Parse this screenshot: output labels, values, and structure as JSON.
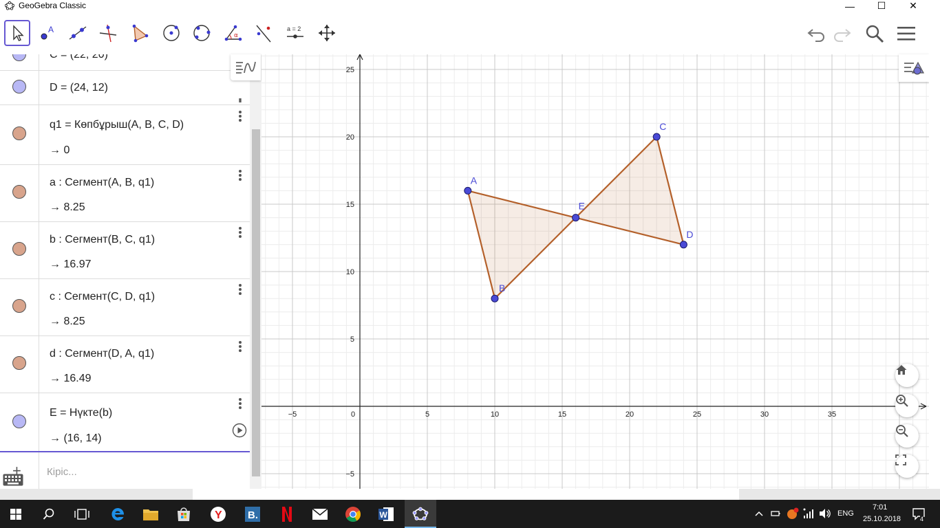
{
  "window": {
    "title": "GeoGebra Classic",
    "controls": {
      "minimize": "—",
      "maximize": "☐",
      "close": "✕"
    }
  },
  "toolbar": {
    "tools": [
      {
        "name": "move-tool",
        "icon": "cursor-arrow-icon",
        "selected": true
      },
      {
        "name": "point-tool",
        "icon": "point-icon",
        "label": "A"
      },
      {
        "name": "line-tool",
        "icon": "line-through-points-icon"
      },
      {
        "name": "perpendicular-tool",
        "icon": "perpendicular-line-icon"
      },
      {
        "name": "polygon-tool",
        "icon": "polygon-icon"
      },
      {
        "name": "circle-tool",
        "icon": "circle-center-point-icon"
      },
      {
        "name": "conic-tool",
        "icon": "ellipse-icon"
      },
      {
        "name": "angle-tool",
        "icon": "angle-icon",
        "label": "α"
      },
      {
        "name": "reflect-tool",
        "icon": "reflect-about-line-icon"
      },
      {
        "name": "slider-tool",
        "icon": "slider-icon",
        "label": "a = 2"
      },
      {
        "name": "move-graphics-tool",
        "icon": "move-cross-arrows-icon"
      }
    ],
    "right": [
      "undo-icon",
      "redo-icon",
      "search-icon",
      "menu-icon"
    ]
  },
  "algebra": {
    "rows": [
      {
        "def": "C = (22, 20)",
        "color": "#b8b8f5"
      },
      {
        "def": "D = (24, 12)",
        "color": "#b8b8f5"
      },
      {
        "def": "q1 = Көпбұрыш(A, B, C, D)",
        "val": "→  0",
        "color": "#d8a48c"
      },
      {
        "def": "a : Сегмент(A, B, q1)",
        "val": "→  8.25",
        "color": "#d8a48c"
      },
      {
        "def": "b : Сегмент(B, C, q1)",
        "val": "→  16.97",
        "color": "#d8a48c"
      },
      {
        "def": "c : Сегмент(C, D, q1)",
        "val": "→  8.25",
        "color": "#d8a48c"
      },
      {
        "def": "d : Сегмент(D, A, q1)",
        "val": "→  16.49",
        "color": "#d8a48c"
      },
      {
        "def": "E = Нүкте(b)",
        "val": "→  (16, 14)",
        "color": "#b8b8f5"
      }
    ],
    "input_placeholder": "Кіріс..."
  },
  "graphics": {
    "x_ticks": [
      "−5",
      "0",
      "5",
      "10",
      "15",
      "20",
      "25",
      "30",
      "35"
    ],
    "y_ticks": [
      "25",
      "20",
      "15",
      "10",
      "5",
      "−5"
    ],
    "points": [
      {
        "label": "A",
        "x": 8,
        "y": 16
      },
      {
        "label": "B",
        "x": 10,
        "y": 8
      },
      {
        "label": "C",
        "x": 22,
        "y": 20
      },
      {
        "label": "D",
        "x": 24,
        "y": 12
      },
      {
        "label": "E",
        "x": 16,
        "y": 14
      }
    ],
    "polygon": [
      "A",
      "B",
      "C",
      "D"
    ],
    "polygon_color": "#b4602a",
    "point_color": "#4a4ad6",
    "buttons": [
      "home-icon",
      "zoom-in-icon",
      "zoom-out-icon",
      "fullscreen-icon"
    ]
  },
  "taskbar": {
    "apps": [
      "windows-start-icon",
      "search-icon",
      "task-view-icon",
      "edge-icon",
      "file-explorer-icon",
      "store-icon",
      "yandex-icon",
      "b-app-icon",
      "netflix-icon",
      "mail-icon",
      "chrome-icon",
      "word-icon",
      "geogebra-icon"
    ],
    "lang": "ENG",
    "time": "7:01",
    "date": "25.10.2018",
    "notifications": "4"
  }
}
